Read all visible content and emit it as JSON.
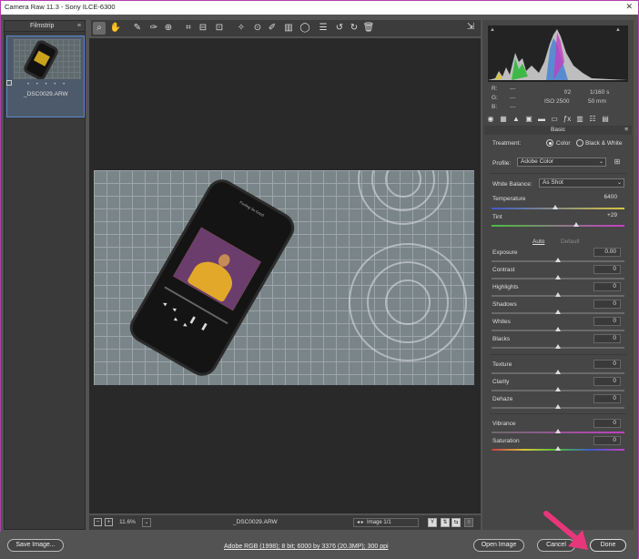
{
  "window": {
    "title": "Camera Raw 11.3  -  Sony ILCE-6300",
    "close_icon": "close-icon"
  },
  "filmstrip": {
    "header": "Filmstrip",
    "items": [
      {
        "filename": "_DSC0029.ARW",
        "stars": "• • • • •"
      }
    ]
  },
  "toolbar": {
    "tools": [
      "zoom-icon",
      "hand-icon",
      "white-balance-icon",
      "color-sampler-icon",
      "target-adjustment-icon",
      "crop-icon",
      "straighten-icon",
      "transform-icon",
      "spot-removal-icon",
      "red-eye-icon",
      "adjustment-brush-icon",
      "graduated-filter-icon",
      "radial-filter-icon",
      "preferences-icon",
      "rotate-ccw-icon",
      "rotate-cw-icon",
      "delete-icon"
    ]
  },
  "canvas": {
    "zoom": "11.6%",
    "filename": "_DSC0029.ARW",
    "image_count": "Image 1/1",
    "photo_caption": "Feeling So Good"
  },
  "histogram": {
    "r_label": "R:",
    "g_label": "G:",
    "b_label": "B:",
    "r_value": "---",
    "g_value": "---",
    "b_value": "---",
    "aperture": "f/2",
    "shutter": "1/160 s",
    "iso": "ISO 2500",
    "focal": "50 mm"
  },
  "panel": {
    "section": "Basic",
    "treatment_label": "Treatment:",
    "treatment_options": [
      "Color",
      "Black & White"
    ],
    "treatment_selected": "Color",
    "profile_label": "Profile:",
    "profile_value": "Adobe Color",
    "wb_label": "White Balance:",
    "wb_value": "As Shot",
    "temperature": {
      "label": "Temperature",
      "value": "6400",
      "pos": 0.48
    },
    "tint": {
      "label": "Tint",
      "value": "+29",
      "pos": 0.64
    },
    "auto": "Auto",
    "default": "Default",
    "tone": [
      {
        "label": "Exposure",
        "value": "0.00",
        "pos": 0.5
      },
      {
        "label": "Contrast",
        "value": "0",
        "pos": 0.5
      },
      {
        "label": "Highlights",
        "value": "0",
        "pos": 0.5
      },
      {
        "label": "Shadows",
        "value": "0",
        "pos": 0.5
      },
      {
        "label": "Whites",
        "value": "0",
        "pos": 0.5
      },
      {
        "label": "Blacks",
        "value": "0",
        "pos": 0.5
      }
    ],
    "presence": [
      {
        "label": "Texture",
        "value": "0",
        "pos": 0.5
      },
      {
        "label": "Clarity",
        "value": "0",
        "pos": 0.5
      },
      {
        "label": "Dehaze",
        "value": "0",
        "pos": 0.5
      }
    ],
    "color": [
      {
        "label": "Vibrance",
        "value": "0",
        "pos": 0.5
      },
      {
        "label": "Saturation",
        "value": "0",
        "pos": 0.5
      }
    ]
  },
  "footer": {
    "save_label": "Save Image...",
    "workflow": "Adobe RGB (1998); 8 bit; 6000 by 3376 (20.3MP); 300 ppi",
    "open_label": "Open Image",
    "cancel_label": "Cancel",
    "done_label": "Done"
  },
  "colors": {
    "accent_arrow": "#e8367a",
    "frame": "#b03fae"
  }
}
